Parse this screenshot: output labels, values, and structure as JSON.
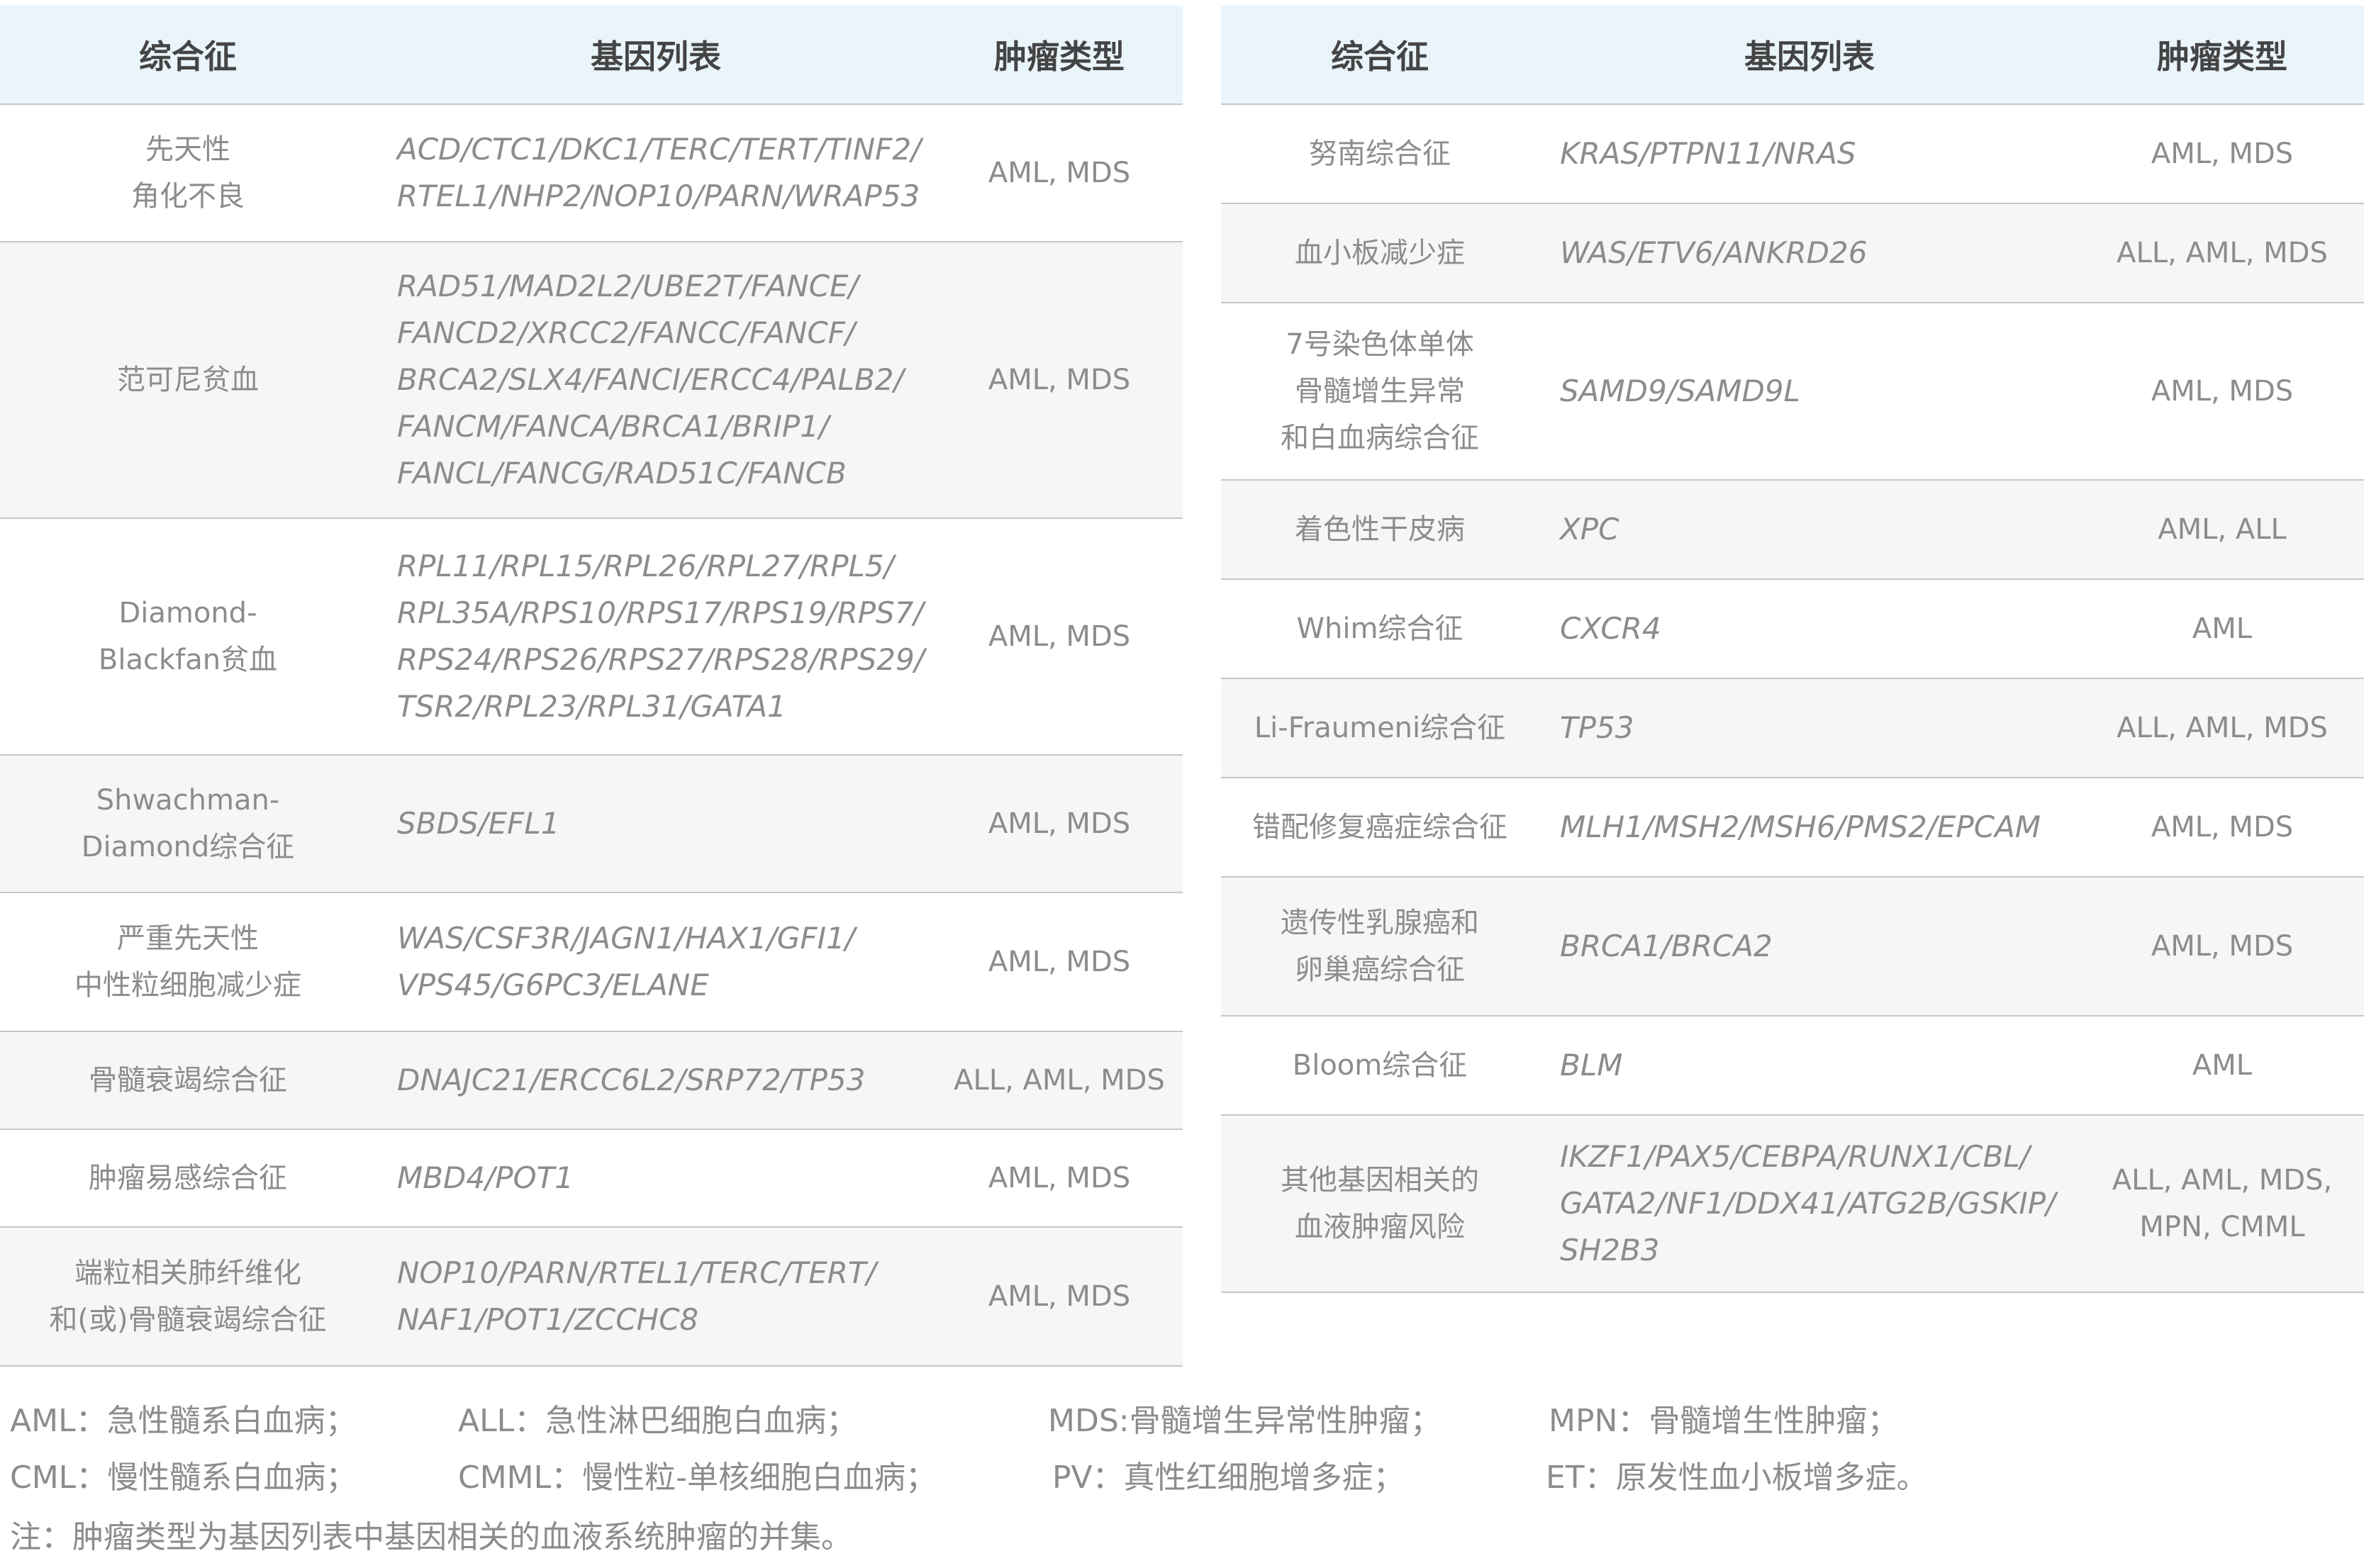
{
  "headers": {
    "syndrome": "综合征",
    "genes": "基因列表",
    "tumor": "肿瘤类型"
  },
  "left_rows": [
    {
      "syndrome": [
        "先天性",
        "角化不良"
      ],
      "genes": [
        "ACD/CTC1/DKC1/TERC/TERT/TINF2/",
        "RTEL1/NHP2/NOP10/PARN/WRAP53"
      ],
      "tumor": [
        "AML, MDS"
      ]
    },
    {
      "syndrome": [
        "范可尼贫血"
      ],
      "genes": [
        "RAD51/MAD2L2/UBE2T/FANCE/",
        "FANCD2/XRCC2/FANCC/FANCF/",
        "BRCA2/SLX4/FANCI/ERCC4/PALB2/",
        "FANCM/FANCA/BRCA1/BRIP1/",
        "FANCL/FANCG/RAD51C/FANCB"
      ],
      "tumor": [
        "AML, MDS"
      ]
    },
    {
      "syndrome": [
        "Diamond-",
        "Blackfan贫血"
      ],
      "genes": [
        "RPL11/RPL15/RPL26/RPL27/RPL5/",
        "RPL35A/RPS10/RPS17/RPS19/RPS7/",
        "RPS24/RPS26/RPS27/RPS28/RPS29/",
        "TSR2/RPL23/RPL31/GATA1"
      ],
      "tumor": [
        "AML, MDS"
      ]
    },
    {
      "syndrome": [
        "Shwachman-",
        "Diamond综合征"
      ],
      "genes": [
        "SBDS/EFL1"
      ],
      "tumor": [
        "AML, MDS"
      ]
    },
    {
      "syndrome": [
        "严重先天性",
        "中性粒细胞减少症"
      ],
      "genes": [
        "WAS/CSF3R/JAGN1/HAX1/GFI1/",
        "VPS45/G6PC3/ELANE"
      ],
      "tumor": [
        "AML, MDS"
      ]
    },
    {
      "syndrome": [
        "骨髓衰竭综合征"
      ],
      "genes": [
        "DNAJC21/ERCC6L2/SRP72/TP53"
      ],
      "tumor": [
        "ALL, AML, MDS"
      ]
    },
    {
      "syndrome": [
        "肿瘤易感综合征"
      ],
      "genes": [
        "MBD4/POT1"
      ],
      "tumor": [
        "AML, MDS"
      ]
    },
    {
      "syndrome": [
        "端粒相关肺纤维化",
        "和(或)骨髓衰竭综合征"
      ],
      "genes": [
        "NOP10/PARN/RTEL1/TERC/TERT/",
        "NAF1/POT1/ZCCHC8"
      ],
      "tumor": [
        "AML, MDS"
      ]
    }
  ],
  "right_rows": [
    {
      "syndrome": [
        "努南综合征"
      ],
      "genes": [
        "KRAS/PTPN11/NRAS"
      ],
      "tumor": [
        "AML, MDS"
      ]
    },
    {
      "syndrome": [
        "血小板减少症"
      ],
      "genes": [
        "WAS/ETV6/ANKRD26"
      ],
      "tumor": [
        "ALL, AML, MDS"
      ]
    },
    {
      "syndrome": [
        "7号染色体单体",
        "骨髓增生异常",
        "和白血病综合征"
      ],
      "genes": [
        "SAMD9/SAMD9L"
      ],
      "tumor": [
        "AML, MDS"
      ]
    },
    {
      "syndrome": [
        "着色性干皮病"
      ],
      "genes": [
        "XPC"
      ],
      "tumor": [
        "AML, ALL"
      ]
    },
    {
      "syndrome": [
        "Whim综合征"
      ],
      "genes": [
        "CXCR4"
      ],
      "tumor": [
        "AML"
      ]
    },
    {
      "syndrome": [
        "Li-Fraumeni综合征"
      ],
      "genes": [
        "TP53"
      ],
      "tumor": [
        "ALL, AML, MDS"
      ]
    },
    {
      "syndrome": [
        "错配修复癌症综合征"
      ],
      "genes": [
        "MLH1/MSH2/MSH6/PMS2/EPCAM"
      ],
      "tumor": [
        "AML, MDS"
      ]
    },
    {
      "syndrome": [
        "遗传性乳腺癌和",
        "卵巢癌综合征"
      ],
      "genes": [
        "BRCA1/BRCA2"
      ],
      "tumor": [
        "AML, MDS"
      ]
    },
    {
      "syndrome": [
        "Bloom综合征"
      ],
      "genes": [
        "BLM"
      ],
      "tumor": [
        "AML"
      ]
    },
    {
      "syndrome": [
        "其他基因相关的",
        "血液肿瘤风险"
      ],
      "genes": [
        "IKZF1/PAX5/CEBPA/RUNX1/CBL/",
        "GATA2/NF1/DDX41/ATG2B/GSKIP/",
        "SH2B3"
      ],
      "tumor": [
        "ALL, AML, MDS,",
        "MPN, CMML"
      ]
    }
  ],
  "legend": {
    "aml": "AML：急性髓系白血病；",
    "all": "ALL：急性淋巴细胞白血病；",
    "mds": "MDS:骨髓增生异常性肿瘤；",
    "mpn": "MPN：骨髓增生性肿瘤；",
    "cml": "CML：慢性髓系白血病；",
    "cmml": "CMML：慢性粒-单核细胞白血病；",
    "pv": "PV：真性红细胞增多症；",
    "et": "ET：原发性血小板增多症。",
    "note": "注：肿瘤类型为基因列表中基因相关的血液系统肿瘤的并集。"
  }
}
